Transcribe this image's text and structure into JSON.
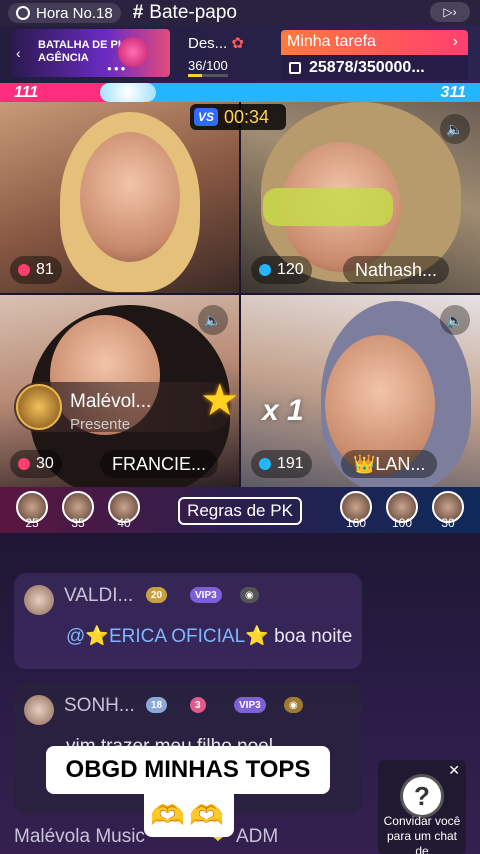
{
  "topbar": {
    "hour_label": "Hora No.18",
    "chat_label": "Bate-papo"
  },
  "info": {
    "banner_text": "BATALHA DE PK AGÊNCIA",
    "des_label": "Des...",
    "des_progress": "36/100",
    "task_label": "Minha tarefa",
    "task_count": "25878/350000..."
  },
  "score": {
    "left": "111",
    "right": "311"
  },
  "timer": {
    "vs": "VS",
    "time": "00:34"
  },
  "streams": [
    {
      "count": "81",
      "name": ""
    },
    {
      "count": "120",
      "name": "Nathash..."
    },
    {
      "count": "30",
      "name": "FRANCIE..."
    },
    {
      "count": "191",
      "name": "👑LAN..."
    }
  ],
  "gift": {
    "sender": "Malévol...",
    "sub": "Presente",
    "multiplier": "x 1"
  },
  "viewers": {
    "left": [
      "25",
      "35",
      "40"
    ],
    "right": [
      "160",
      "100",
      "30"
    ],
    "rules_label": "Regras de PK"
  },
  "chat": {
    "messages": [
      {
        "user": "VALDI...",
        "badges": [
          "20",
          "VIP3"
        ],
        "text_mention": "@⭐ERICA OFICIAL⭐",
        "text": " boa noite"
      },
      {
        "user": "SONH...",
        "badges": [
          "18",
          "3",
          "VIP3"
        ],
        "text": "vim trazer  meu  filho noel"
      }
    ],
    "bottom_user": "Malévola Music",
    "bottom_role": "ADM"
  },
  "caption": {
    "text": "OBGD MINHAS TOPS",
    "emoji": "🫶🫶"
  },
  "invite": {
    "text": "Convidar você para um chat de"
  }
}
